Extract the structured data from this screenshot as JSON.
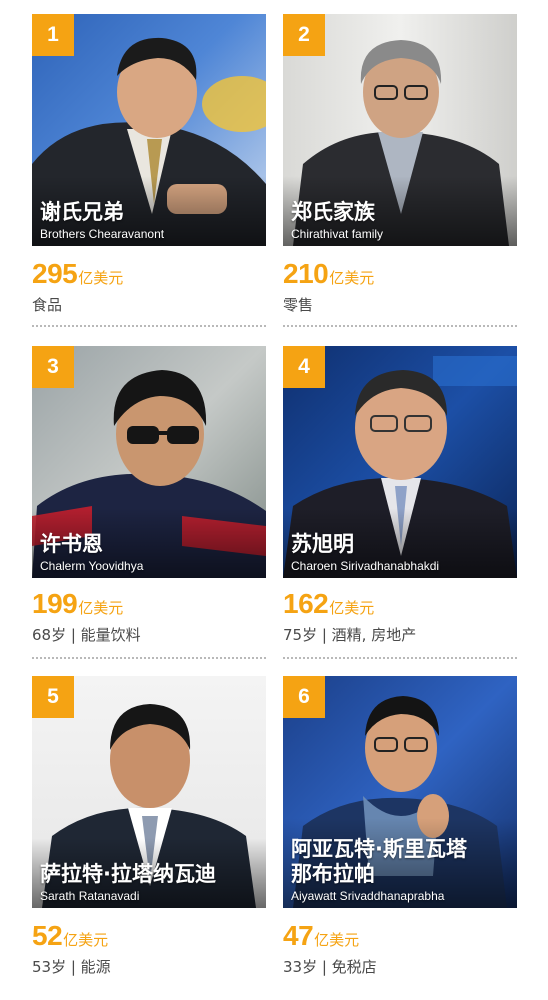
{
  "colors": {
    "accent": "#f5a313",
    "text": "#4a4a4a"
  },
  "cards": [
    {
      "rank": "1",
      "name_zh": "谢氏兄弟",
      "name_en": "Brothers Chearavanont",
      "wealth": "295",
      "unit": "亿美元",
      "desc": "食品"
    },
    {
      "rank": "2",
      "name_zh": "郑氏家族",
      "name_en": "Chirathivat family",
      "wealth": "210",
      "unit": "亿美元",
      "desc": "零售"
    },
    {
      "rank": "3",
      "name_zh": "许书恩",
      "name_en": "Chalerm Yoovidhya",
      "wealth": "199",
      "unit": "亿美元",
      "desc": "68岁 | 能量饮料"
    },
    {
      "rank": "4",
      "name_zh": "苏旭明",
      "name_en": "Charoen Sirivadhanabhakdi",
      "wealth": "162",
      "unit": "亿美元",
      "desc": "75岁 | 酒精, 房地产"
    },
    {
      "rank": "5",
      "name_zh": "萨拉特·拉塔纳瓦迪",
      "name_en": "Sarath Ratanavadi",
      "wealth": "52",
      "unit": "亿美元",
      "desc": "53岁 | 能源"
    },
    {
      "rank": "6",
      "name_zh_line1": "阿亚瓦特·斯里瓦塔",
      "name_zh_line2": "那布拉帕",
      "name_en": "Aiyawatt Srivaddhanaprabha",
      "wealth": "47",
      "unit": "亿美元",
      "desc": "33岁 | 免税店"
    }
  ]
}
